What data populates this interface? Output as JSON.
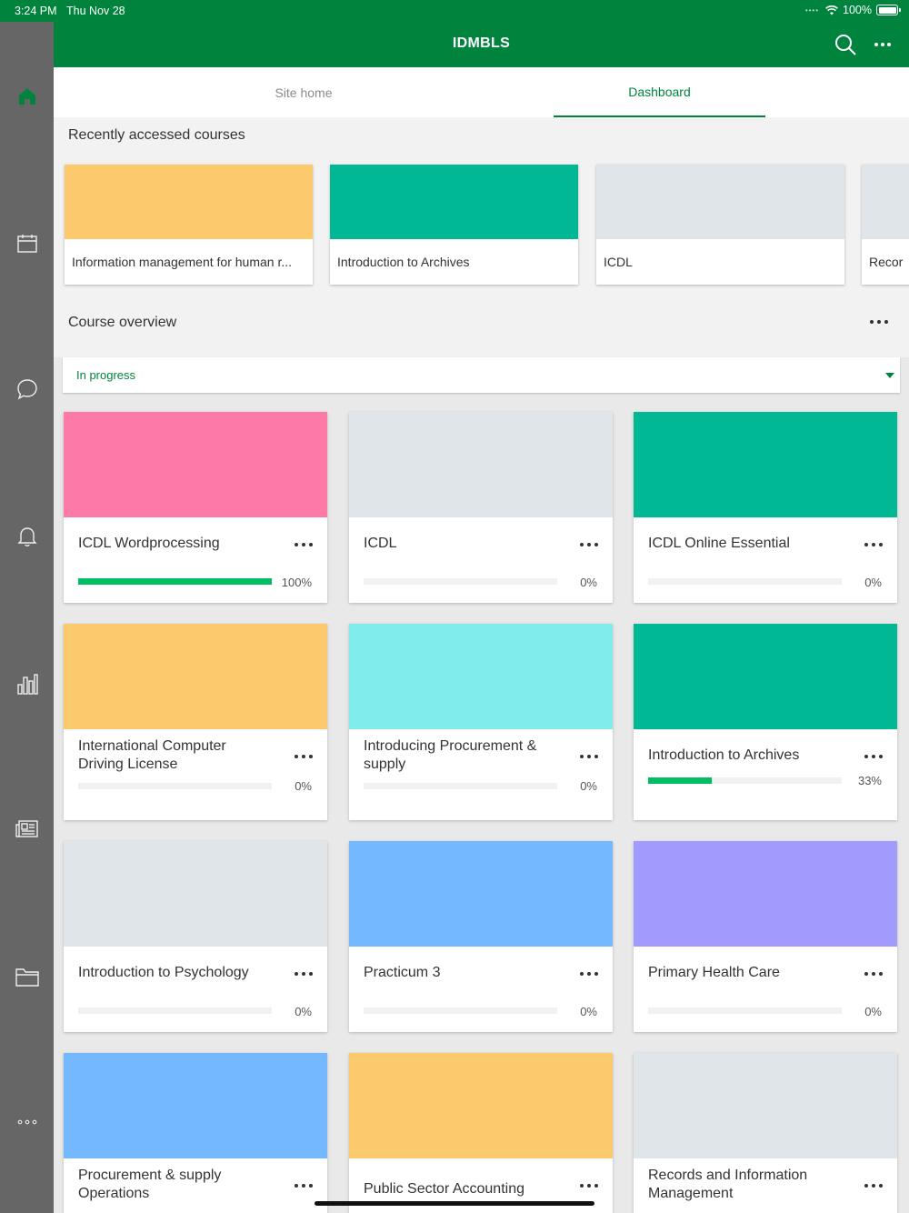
{
  "status": {
    "time": "3:24 PM",
    "date": "Thu Nov 28",
    "battery": "100%"
  },
  "header": {
    "title": "IDMBLS"
  },
  "tabs": [
    {
      "label": "Site home"
    },
    {
      "label": "Dashboard"
    }
  ],
  "sidebar": {
    "items": [
      "home-icon",
      "calendar-icon",
      "messages-icon",
      "notifications-icon",
      "grades-icon",
      "news-icon",
      "files-icon",
      "more-icon"
    ]
  },
  "recent": {
    "title": "Recently accessed courses",
    "courses": [
      {
        "name": "Information management for human r...",
        "color": "#fcc96d"
      },
      {
        "name": "Introduction to Archives",
        "color": "#00b894"
      },
      {
        "name": "ICDL",
        "color": "#dfe5e8"
      },
      {
        "name": "Recor",
        "color": "#dfe5e8"
      }
    ]
  },
  "overview": {
    "title": "Course overview",
    "filter": "In progress"
  },
  "courses": [
    {
      "name": "ICDL Wordprocessing",
      "color": "#fd79a8",
      "progress": 100,
      "pct": "100%"
    },
    {
      "name": "ICDL",
      "color": "#dfe5e8",
      "progress": 0,
      "pct": "0%"
    },
    {
      "name": "ICDL Online Essential",
      "color": "#00b894",
      "progress": 0,
      "pct": "0%"
    },
    {
      "name": "International Computer Driving License",
      "color": "#fcc96d",
      "progress": 0,
      "pct": "0%"
    },
    {
      "name": "Introducing Procurement & supply",
      "color": "#81ecec",
      "progress": 0,
      "pct": "0%"
    },
    {
      "name": "Introduction to Archives",
      "color": "#00b894",
      "progress": 33,
      "pct": "33%"
    },
    {
      "name": "Introduction to Psychology",
      "color": "#dfe5e8",
      "progress": 0,
      "pct": "0%"
    },
    {
      "name": "Practicum 3",
      "color": "#74b9ff",
      "progress": 0,
      "pct": "0%"
    },
    {
      "name": "Primary Health Care",
      "color": "#a29bfe",
      "progress": 0,
      "pct": "0%"
    },
    {
      "name": "Procurement & supply Operations",
      "color": "#74b9ff",
      "progress": null,
      "pct": ""
    },
    {
      "name": "Public Sector Accounting",
      "color": "#fcc96d",
      "progress": null,
      "pct": ""
    },
    {
      "name": "Records and Information Management",
      "color": "#dfe5e8",
      "progress": null,
      "pct": ""
    }
  ]
}
